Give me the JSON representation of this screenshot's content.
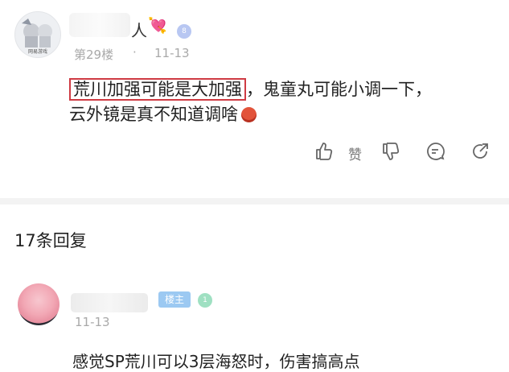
{
  "post": {
    "avatar_caption": "网易游戏",
    "name_tail": "人",
    "heart": "💘",
    "level": "8",
    "floor": "第29楼",
    "dot": "·",
    "date": "11-13",
    "text_highlight": "荒川加强可能是大加强",
    "text_rest": "，鬼童丸可能小调一下，",
    "text_line2": "云外镜是真不知道调啥",
    "actions": {
      "like_label": "赞",
      "icons": [
        "thumbs-up-icon",
        "thumbs-down-icon",
        "comment-icon",
        "share-icon"
      ]
    }
  },
  "replies": {
    "count_label": "17条回复"
  },
  "reply": {
    "owner_badge": "楼主",
    "level": "1",
    "date": "11-13",
    "text": "感觉SP荒川可以3层海怒时，伤害搞高点"
  },
  "colors": {
    "highlight_border": "#cf3b43",
    "meta_gray": "#a9a9a9",
    "owner_badge": "#9cc9f2"
  }
}
